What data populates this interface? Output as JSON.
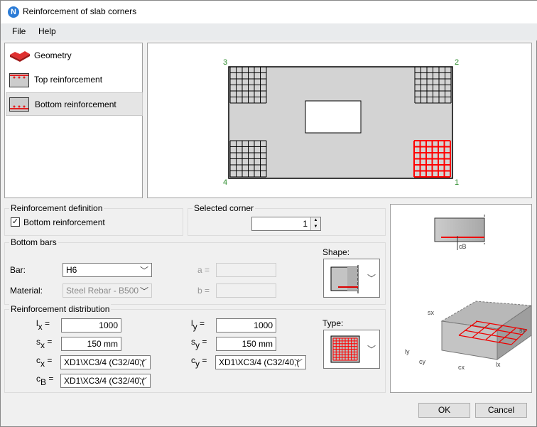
{
  "window": {
    "title": "Reinforcement of slab corners",
    "app_icon": "N"
  },
  "menu": [
    "File",
    "Help"
  ],
  "nav": [
    {
      "label": "Geometry",
      "icon": "slab-geometry-icon"
    },
    {
      "label": "Top reinforcement",
      "icon": "top-reinforcement-icon"
    },
    {
      "label": "Bottom reinforcement",
      "icon": "bottom-reinforcement-icon",
      "selected": true
    }
  ],
  "preview": {
    "corners": [
      "1",
      "2",
      "3",
      "4"
    ],
    "selected_corner": "1",
    "highlight_color": "#ff0000"
  },
  "definition": {
    "title": "Reinforcement definition",
    "checkbox_label": "Bottom reinforcement",
    "checked": true
  },
  "corner": {
    "title": "Selected corner",
    "value": "1"
  },
  "bars": {
    "title": "Bottom bars",
    "bar_label": "Bar:",
    "bar_value": "H6",
    "material_label": "Material:",
    "material_value": "Steel Rebar - B500",
    "a_label": "a =",
    "b_label": "b =",
    "shape_label": "Shape:"
  },
  "dist": {
    "title": "Reinforcement distribution",
    "lx": "l",
    "lx_sub": "x",
    "lx_value": "1000",
    "ly": "l",
    "ly_sub": "y",
    "ly_value": "1000",
    "sx": "s",
    "sx_sub": "x",
    "sx_value": "150 mm",
    "sy": "s",
    "sy_sub": "y",
    "sy_value": "150 mm",
    "cx": "c",
    "cx_sub": "x",
    "cx_value": "XD1\\XC3/4 (C32/40,(",
    "cy": "c",
    "cy_sub": "y",
    "cy_value": "XD1\\XC3/4 (C32/40,(",
    "cb": "c",
    "cb_sub": "B",
    "cb_value": "XD1\\XC3/4 (C32/40,(",
    "eq": "=",
    "type_label": "Type:"
  },
  "diagram": {
    "cb": "cB",
    "sx": "sx",
    "sy": "sy",
    "ly": "ly",
    "cy": "cy",
    "cx": "cx",
    "lx": "lx"
  },
  "buttons": {
    "ok": "OK",
    "cancel": "Cancel"
  }
}
